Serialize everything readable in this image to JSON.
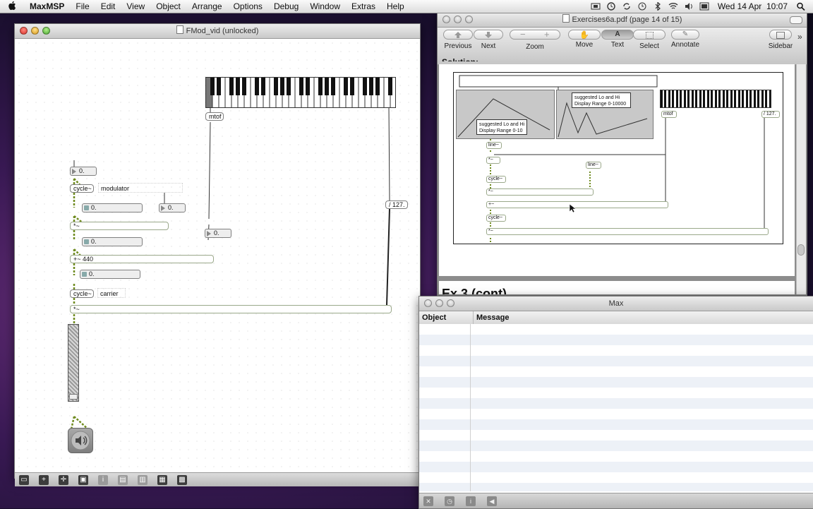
{
  "menubar": {
    "apple": "",
    "app_name": "MaxMSP",
    "items": [
      "File",
      "Edit",
      "View",
      "Object",
      "Arrange",
      "Options",
      "Debug",
      "Window",
      "Extras",
      "Help"
    ],
    "clock": "Wed 14 Apr  10:07"
  },
  "patcher": {
    "title": "FMod_vid (unlocked)",
    "objects": {
      "mtof": "mtof",
      "num_top": "0.",
      "cycle_mod": "cycle~",
      "comment_modulator": "modulator",
      "num_index": "0.",
      "num_right": "0.",
      "mult1": "*~",
      "num_freq": "0.",
      "num_mid": "0.",
      "add440": "+~ 440",
      "num_amp": "0.",
      "cycle_car": "cycle~",
      "comment_carrier": "carrier",
      "div127": "/ 127.",
      "mult2": "*~"
    }
  },
  "preview": {
    "title": "Exercises6a.pdf (page 14 of 15)",
    "toolbar": {
      "previous": "Previous",
      "next": "Next",
      "zoom": "Zoom",
      "move": "Move",
      "text": "Text",
      "select": "Select",
      "annotate": "Annotate",
      "sidebar": "Sidebar"
    },
    "page_top_cut": "Solution:",
    "figure": {
      "label_lohi_1": "suggested Lo and Hi",
      "label_range_1": "Display Range 0-10",
      "label_lohi_2": "suggested Lo and Hi",
      "label_range_2": "Display Range 0-10000",
      "mtof": "mtof",
      "div127": "/ 127.",
      "line1": "line~",
      "line2": "line~",
      "mult_a": "*~",
      "cycle_a": "cycle~",
      "mult_b": "*~",
      "plus": "+~",
      "cycle_b": "cycle~",
      "mult_c": "*~"
    },
    "next_page_cut": "Ex 3 (cont)"
  },
  "console": {
    "title": "Max",
    "col_object": "Object",
    "col_message": "Message"
  }
}
